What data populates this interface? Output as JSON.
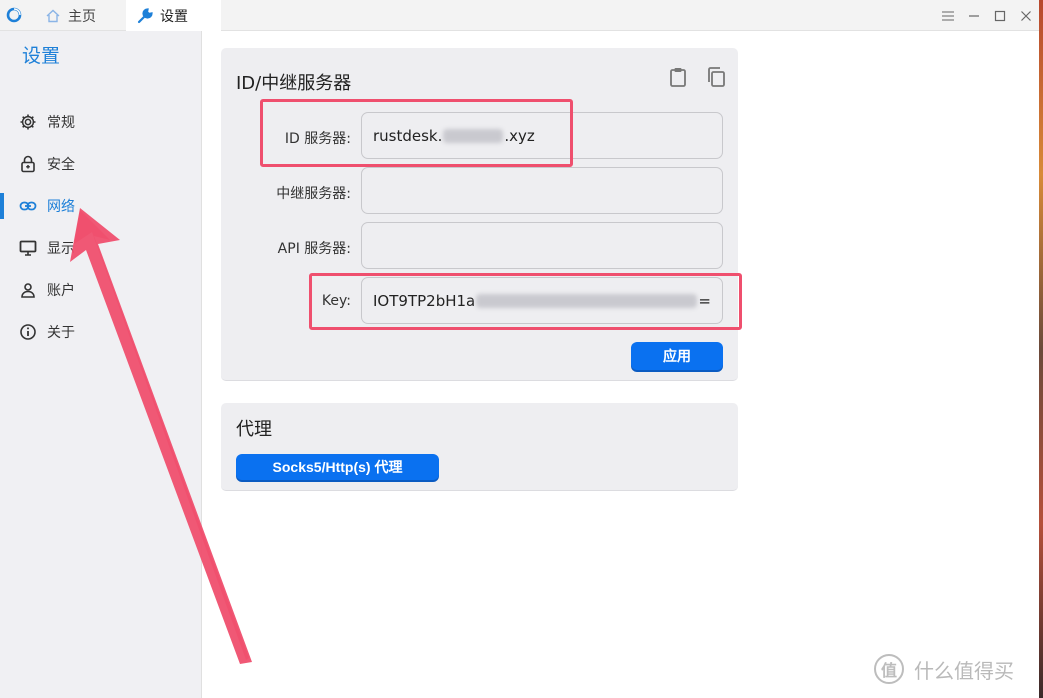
{
  "titlebar": {
    "tabs": [
      {
        "label": "主页",
        "icon": "home-icon"
      },
      {
        "label": "设置",
        "icon": "wrench-icon"
      }
    ],
    "controls": [
      "menu-icon",
      "minimize-icon",
      "maximize-icon",
      "close-icon"
    ]
  },
  "sidebar": {
    "title": "设置",
    "items": [
      {
        "label": "常规",
        "icon": "gear-icon"
      },
      {
        "label": "安全",
        "icon": "lock-icon"
      },
      {
        "label": "网络",
        "icon": "link-icon",
        "active": true
      },
      {
        "label": "显示",
        "icon": "monitor-icon"
      },
      {
        "label": "账户",
        "icon": "user-icon"
      },
      {
        "label": "关于",
        "icon": "info-icon"
      }
    ]
  },
  "relay": {
    "title": "ID/中继服务器",
    "fields": [
      {
        "label": "ID 服务器:",
        "value_prefix": "rustdesk.",
        "value_suffix": ".xyz"
      },
      {
        "label": "中继服务器:",
        "value": ""
      },
      {
        "label": "API 服务器:",
        "value": ""
      },
      {
        "label": "Key:",
        "value_prefix": "IOT9TP2bH1a",
        "value_suffix": "="
      }
    ],
    "apply_label": "应用"
  },
  "proxy": {
    "title": "代理",
    "button_label": "Socks5/Http(s) 代理"
  },
  "watermark": {
    "logo": "值",
    "text": "什么值得买"
  },
  "colors": {
    "accent": "#1e80d8",
    "button": "#0a71f0",
    "annotation": "#ef4f6e"
  }
}
